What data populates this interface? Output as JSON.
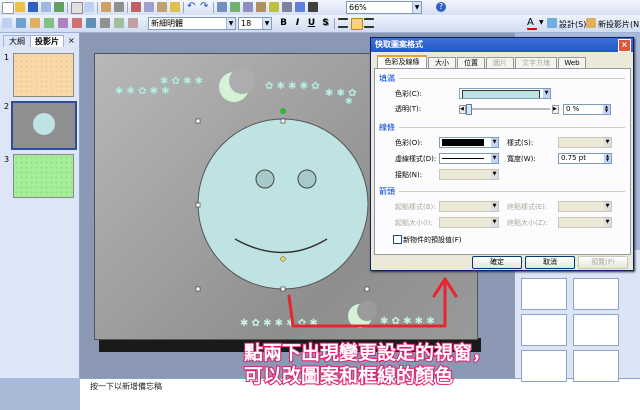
{
  "toolbar": {
    "font_name": "新細明體",
    "font_size": "18",
    "bold": "B",
    "italic": "I",
    "underline": "U",
    "shadow": "S",
    "zoom": "66%",
    "help": "?",
    "design_label": "設計(S)",
    "new_slide_label": "新投影片(N)"
  },
  "left_pane": {
    "tab_outline": "大綱",
    "tab_slides": "投影片",
    "slides": [
      {
        "number": "1",
        "color": "#f9d9aa"
      },
      {
        "number": "2",
        "color": "#8f8f8f"
      },
      {
        "number": "3",
        "color": "#a6ee9a"
      }
    ]
  },
  "notes": {
    "placeholder": "按一下以新增備忘稿"
  },
  "slide": {
    "background": "#a2a2a2",
    "face_color": "#bfe3e3",
    "stars_color": "#c9f0e0",
    "moon_color": "#d6f2d6"
  },
  "dialog": {
    "title": "快取圖案格式",
    "close": "×",
    "tabs": [
      {
        "label": "色彩及線條",
        "state": "active"
      },
      {
        "label": "大小",
        "state": "normal"
      },
      {
        "label": "位置",
        "state": "normal"
      },
      {
        "label": "圖片",
        "state": "disabled"
      },
      {
        "label": "文字方塊",
        "state": "disabled"
      },
      {
        "label": "Web",
        "state": "normal"
      }
    ],
    "fill": {
      "section": "填滿",
      "color_label": "色彩(C):",
      "color_value": "#bfe3e3",
      "transparency_label": "透明(T):",
      "transparency_value": "0 %"
    },
    "line": {
      "section": "線條",
      "color_label": "色彩(O):",
      "color_value": "#000000",
      "dash_label": "虛線樣式(D):",
      "connector_label": "接點(N):",
      "style_label": "樣式(S):",
      "weight_label": "寬度(W):",
      "weight_value": "0.75 pt"
    },
    "arrows": {
      "section": "箭頭",
      "begin_style_label": "起點樣式(B):",
      "begin_size_label": "起點大小(I):",
      "end_style_label": "終點樣式(E):",
      "end_size_label": "終點大小(Z):"
    },
    "default_checkbox_label": "新物件的預設值(F)",
    "ok_label": "確定",
    "cancel_label": "取消",
    "preview_label": "預覽(P)"
  },
  "annotation": {
    "line1": "點兩下出現變更設定的視窗，",
    "line2": "可以改圖案和框線的顏色",
    "arrow_color": "#e8242e"
  }
}
